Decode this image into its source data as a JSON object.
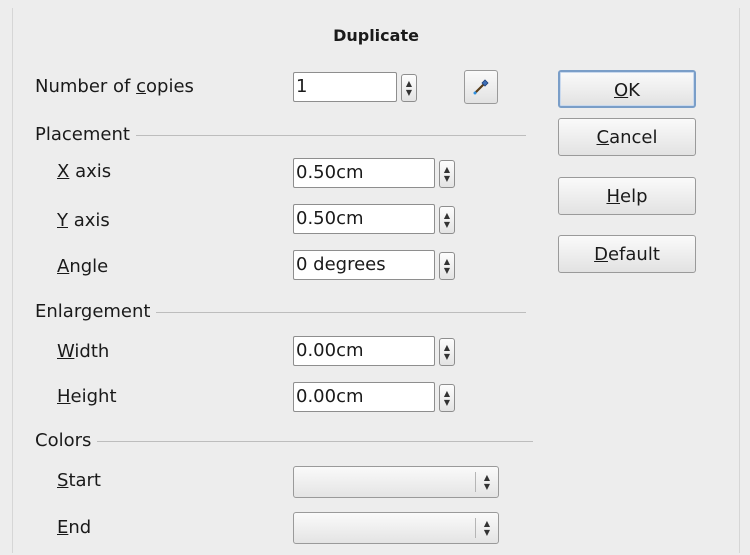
{
  "dialog": {
    "title": "Duplicate",
    "copies": {
      "label_pre": "Number of ",
      "label_acc": "c",
      "label_post": "opies",
      "value": "1"
    },
    "placement": {
      "heading": "Placement",
      "x_axis": {
        "acc": "X",
        "rest": " axis",
        "value": "0.50cm"
      },
      "y_axis": {
        "acc": "Y",
        "rest": " axis",
        "value": "0.50cm"
      },
      "angle": {
        "acc": "A",
        "rest": "ngle",
        "value": "0 degrees"
      }
    },
    "enlargement": {
      "heading": "Enlargement",
      "width": {
        "acc": "W",
        "rest": "idth",
        "value": "0.00cm"
      },
      "height": {
        "acc": "H",
        "rest": "eight",
        "value": "0.00cm"
      }
    },
    "colors": {
      "heading": "Colors",
      "start": {
        "acc": "S",
        "rest": "tart",
        "value": ""
      },
      "end": {
        "acc": "E",
        "rest": "nd",
        "value": ""
      }
    },
    "buttons": {
      "ok": {
        "acc": "O",
        "rest": "K"
      },
      "cancel": {
        "acc": "C",
        "rest": "ancel"
      },
      "help": {
        "acc": "H",
        "rest": "elp"
      },
      "default": {
        "acc": "D",
        "rest": "efault"
      }
    },
    "icons": {
      "picker": "eyedropper-icon"
    }
  }
}
